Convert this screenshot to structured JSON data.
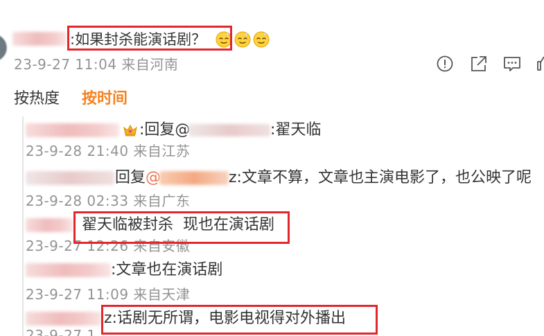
{
  "colors": {
    "text": "#333333",
    "meta": "#939393",
    "accent": "#f5821f",
    "link": "#eb7350",
    "highlight": "#e3262b",
    "thread_line": "#e4e4e4",
    "icon": "#555555"
  },
  "post": {
    "text": ":如果封杀能演话剧？",
    "emojis": [
      "sweat-face-icon",
      "sweat-face-icon",
      "sweat-face-icon"
    ],
    "meta": "23-9-27 11:04 来自河南",
    "actions": [
      "report-icon",
      "share-icon",
      "comment-icon",
      "like-icon"
    ]
  },
  "sort": {
    "hot": "按热度",
    "time": "按时间"
  },
  "replies": [
    {
      "prefix": ":回复@",
      "text": ":翟天临",
      "meta": "23-9-28 21:40 来自江苏"
    },
    {
      "prefix": "回复",
      "mention_at": "@",
      "text": "z:文章不算，文章也主演电影了，也公映了呢",
      "meta": "23-9-28 02:33 来自广东"
    },
    {
      "text": "翟天临被封杀  现也在演话剧",
      "meta": "23-9-27 12:26 来自安徽"
    },
    {
      "text": ":文章也在演话剧",
      "meta": "23-9-27 11:09 来自天津"
    },
    {
      "text": "z:话剧无所谓，电影电视得对外播出",
      "meta": "23-9-27 1"
    }
  ]
}
